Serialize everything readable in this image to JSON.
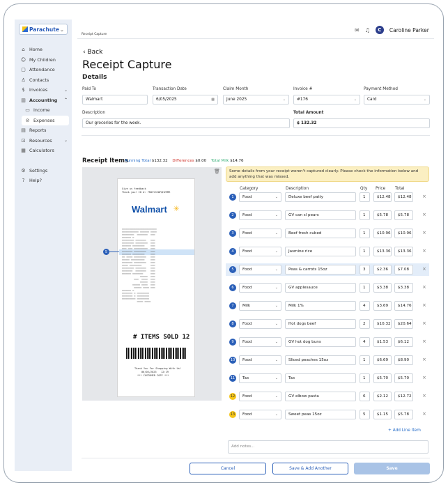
{
  "sidebar": {
    "logo": "Parachute",
    "items": [
      {
        "label": "Home",
        "icon": "home-icon"
      },
      {
        "label": "My Children",
        "icon": "children-icon"
      },
      {
        "label": "Attendance",
        "icon": "attendance-icon"
      },
      {
        "label": "Contacts",
        "icon": "contacts-icon"
      },
      {
        "label": "Invoices",
        "icon": "invoices-icon"
      },
      {
        "label": "Accounting",
        "icon": "accounting-icon"
      },
      {
        "label": "Income",
        "icon": "income-icon"
      },
      {
        "label": "Expenses",
        "icon": "expenses-icon"
      },
      {
        "label": "Reports",
        "icon": "reports-icon"
      },
      {
        "label": "Resources",
        "icon": "resources-icon"
      },
      {
        "label": "Calculators",
        "icon": "calculator-icon"
      },
      {
        "label": "Settings",
        "icon": "settings-icon"
      },
      {
        "label": "Help?",
        "icon": "help-icon"
      }
    ]
  },
  "topbar": {
    "breadcrumb": "Receipt Capture",
    "user_initial": "C",
    "user_name": "Caroline Parker"
  },
  "page": {
    "back": "Back",
    "title": "Receipt Capture",
    "details_heading": "Details"
  },
  "details": {
    "paid_to_label": "Paid To",
    "paid_to": "Walmart",
    "transaction_date_label": "Transaction Date",
    "transaction_date": "6/05/2025",
    "claim_month_label": "Claim Month",
    "claim_month": "June 2025",
    "invoice_label": "Invoice #",
    "invoice": "#176",
    "payment_method_label": "Payment Method",
    "payment_method": "Card",
    "description_label": "Description",
    "description": "Our groceries for the week.",
    "total_amount_label": "Total Amount",
    "total_amount": "$ 132.32"
  },
  "receipt_items": {
    "title": "Receipt Items",
    "running_total_label": "Running Total",
    "running_total": "$132.32",
    "differences_label": "Differences",
    "differences": "$0.00",
    "total_milk_label": "Total Milk",
    "total_milk": "$14.76",
    "notice": "Some details from your receipt weren't captured clearly. Please check the information below and add anything that was missed.",
    "col_category": "Category",
    "col_description": "Description",
    "col_qty": "Qty",
    "col_price": "Price",
    "col_total": "Total",
    "rows": [
      {
        "n": "1",
        "category": "Food",
        "description": "Deluxe beef patty",
        "qty": "1",
        "price": "$12.48",
        "total": "$12.48"
      },
      {
        "n": "2",
        "category": "Food",
        "description": "GV can sl pears",
        "qty": "1",
        "price": "$5.78",
        "total": "$5.78"
      },
      {
        "n": "3",
        "category": "Food",
        "description": "Beef fresh cubed",
        "qty": "1",
        "price": "$10.96",
        "total": "$10.96"
      },
      {
        "n": "4",
        "category": "Food",
        "description": "Jasmine rice",
        "qty": "1",
        "price": "$13.36",
        "total": "$13.36"
      },
      {
        "n": "5",
        "category": "Food",
        "description": "Peas & carrots 15oz",
        "qty": "3",
        "price": "$2.36",
        "total": "$7.08"
      },
      {
        "n": "6",
        "category": "Food",
        "description": "GV applesauce",
        "qty": "1",
        "price": "$3.38",
        "total": "$3.38"
      },
      {
        "n": "7",
        "category": "Milk",
        "description": "Milk 1%",
        "qty": "4",
        "price": "$3.69",
        "total": "$14.76"
      },
      {
        "n": "8",
        "category": "Food",
        "description": "Hot dogs beef",
        "qty": "2",
        "price": "$10.32",
        "total": "$20.64"
      },
      {
        "n": "9",
        "category": "Food",
        "description": "GV hot dog buns",
        "qty": "4",
        "price": "$1.53",
        "total": "$6.12"
      },
      {
        "n": "10",
        "category": "Food",
        "description": "Sliced peaches 15oz",
        "qty": "1",
        "price": "$6.69",
        "total": "$8.90"
      },
      {
        "n": "11",
        "category": "Tax",
        "description": "Tax",
        "qty": "1",
        "price": "$5.70",
        "total": "$5.70"
      },
      {
        "n": "12",
        "category": "Food",
        "description": "GV elbow pasta",
        "qty": "6",
        "price": "$2.12",
        "total": "$12.72"
      },
      {
        "n": "13",
        "category": "Food",
        "description": "Sweet peas 15oz",
        "qty": "5",
        "price": "$1.15",
        "total": "$5.78"
      }
    ],
    "add_line": "+ Add Line Item",
    "notes_placeholder": "Add notes..."
  },
  "receipt_image": {
    "feedback1": "Give us feedback",
    "feedback2": "Thank you! ID #: 7N53YXCWFQHZ9MR",
    "store": "Walmart",
    "items_sold": "# ITEMS SOLD 12",
    "thanks": "Thank You For Shopping With Us!",
    "date": "06/05/2025   12:19",
    "copy": "*** CUSTOMER COPY ***",
    "marker": "5"
  },
  "footer": {
    "cancel": "Cancel",
    "save_add": "Save & Add Another",
    "save": "Save"
  }
}
